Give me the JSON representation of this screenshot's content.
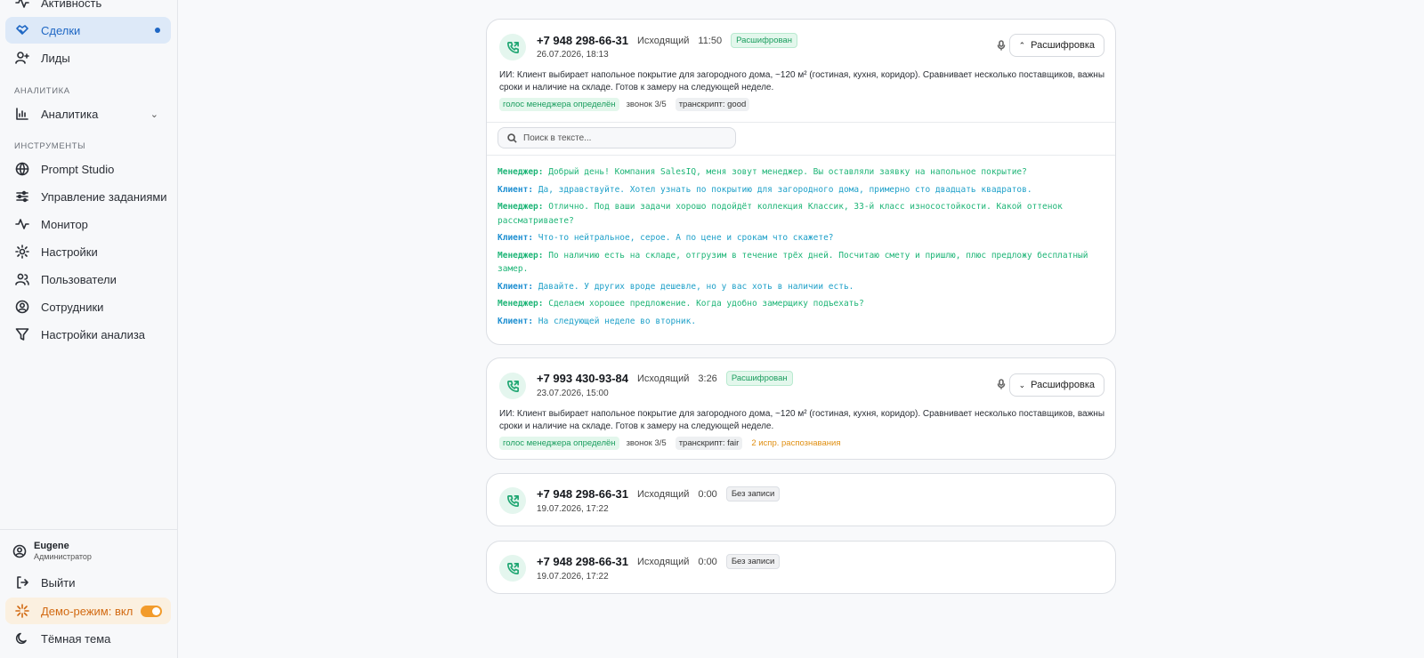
{
  "sidebar": {
    "items_top": [
      {
        "label": "Активность",
        "icon": "activity-icon"
      },
      {
        "label": "Сделки",
        "icon": "handshake-icon",
        "active": true
      },
      {
        "label": "Лиды",
        "icon": "user-plus-icon"
      }
    ],
    "section_analytics": "АНАЛИТИКА",
    "analytics_item": "Аналитика",
    "section_tools": "ИНСТРУМЕНТЫ",
    "tools": [
      {
        "label": "Prompt Studio",
        "icon": "globe-icon"
      },
      {
        "label": "Управление заданиями",
        "icon": "sliders-icon"
      },
      {
        "label": "Монитор",
        "icon": "pulse-icon"
      },
      {
        "label": "Настройки",
        "icon": "gear-icon"
      },
      {
        "label": "Пользователи",
        "icon": "users-icon"
      },
      {
        "label": "Сотрудники",
        "icon": "user-circle-icon"
      },
      {
        "label": "Настройки анализа",
        "icon": "filter-icon"
      }
    ],
    "user": {
      "name": "Eugene",
      "role": "Администратор"
    },
    "logout": "Выйти",
    "demo": "Демо-режим: вкл",
    "theme": "Тёмная тема"
  },
  "calls": [
    {
      "phone": "+7 948 298-66-31",
      "direction": "Исходящий",
      "duration": "11:50",
      "badge": "Расшифрован",
      "date": "26.07.2026, 18:13",
      "button": "Расшифровка",
      "summary": "ИИ: Клиент выбирает напольное покрытие для загородного дома, ~120 м² (гостиная, кухня, коридор). Сравнивает несколько поставщиков, важны сроки и наличие на складе. Готов к замеру на следующей неделе.",
      "tags": [
        "голос менеджера определён",
        "звонок 3/5",
        "транскрипт: good"
      ],
      "search_placeholder": "Поиск в тексте...",
      "transcript": [
        {
          "speaker": "Менеджер:",
          "text": "Добрый день! Компания SalesIQ, меня зовут менеджер. Вы оставляли заявку на напольное покрытие?"
        },
        {
          "speaker": "Клиент:",
          "text": "Да, здравствуйте. Хотел узнать по покрытию для загородного дома, примерно сто двадцать квадратов."
        },
        {
          "speaker": "Менеджер:",
          "text": "Отлично. Под ваши задачи хорошо подойдёт коллекция Классик, 33-й класс износостойкости. Какой оттенок рассматриваете?"
        },
        {
          "speaker": "Клиент:",
          "text": "Что-то нейтральное, серое. А по цене и срокам что скажете?"
        },
        {
          "speaker": "Менеджер:",
          "text": "По наличию есть на складе, отгрузим в течение трёх дней. Посчитаю смету и пришлю, плюс предложу бесплатный замер."
        },
        {
          "speaker": "Клиент:",
          "text": "Давайте. У других вроде дешевле, но у вас хоть в наличии есть."
        },
        {
          "speaker": "Менеджер:",
          "text": "Сделаем хорошее предложение. Когда удобно замерщику подъехать?"
        },
        {
          "speaker": "Клиент:",
          "text": "На следующей неделе во вторник."
        }
      ]
    },
    {
      "phone": "+7 993 430-93-84",
      "direction": "Исходящий",
      "duration": "3:26",
      "badge": "Расшифрован",
      "date": "23.07.2026, 15:00",
      "button": "Расшифровка",
      "summary": "ИИ: Клиент выбирает напольное покрытие для загородного дома, ~120 м² (гостиная, кухня, коридор). Сравнивает несколько поставщиков, важны сроки и наличие на складе. Готов к замеру на следующей неделе.",
      "tags": [
        "голос менеджера определён",
        "звонок 3/5",
        "транскрипт: fair",
        "2 испр. распознавания"
      ]
    },
    {
      "phone": "+7 948 298-66-31",
      "direction": "Исходящий",
      "duration": "0:00",
      "badge": "Без записи",
      "date": "19.07.2026, 17:22"
    },
    {
      "phone": "+7 948 298-66-31",
      "direction": "Исходящий",
      "duration": "0:00",
      "badge": "Без записи",
      "date": "19.07.2026, 17:22"
    }
  ]
}
